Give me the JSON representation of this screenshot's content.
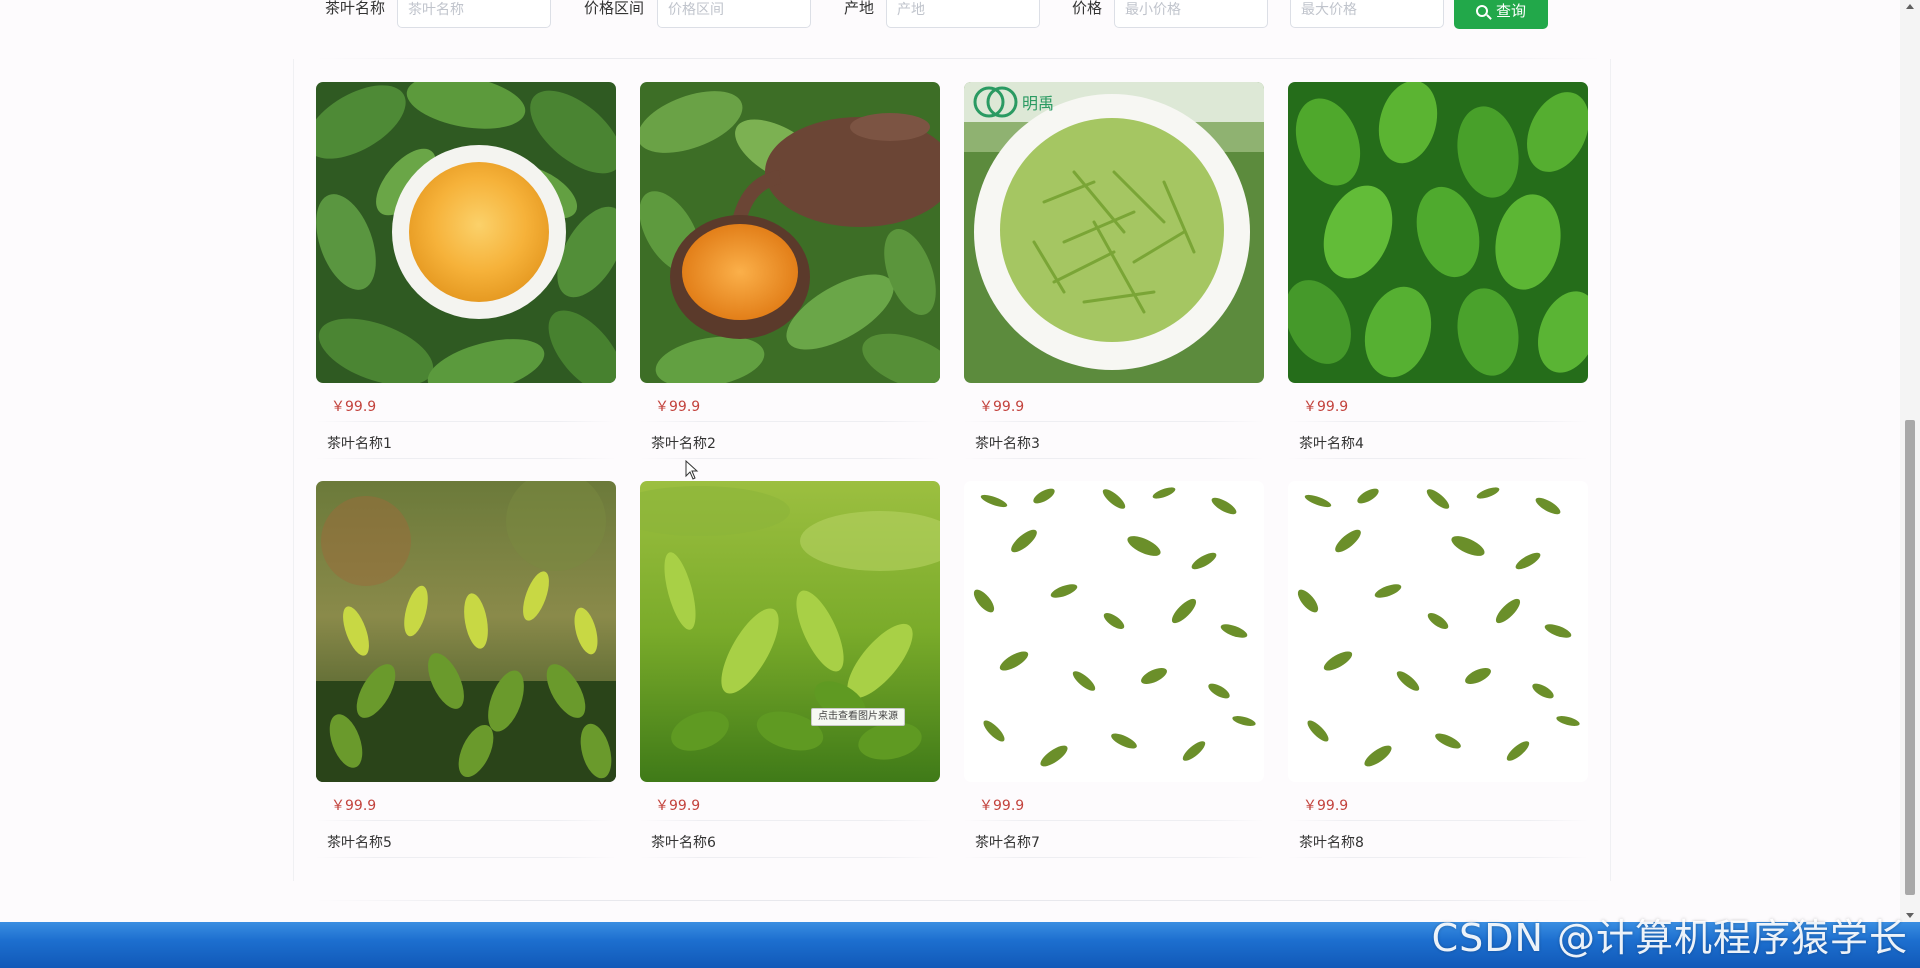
{
  "search": {
    "fields": [
      {
        "label": "茶叶名称",
        "placeholder": "茶叶名称"
      },
      {
        "label": "价格区间",
        "placeholder": "价格区间"
      },
      {
        "label": "产地",
        "placeholder": "产地"
      },
      {
        "label": "价格",
        "placeholder": "最小价格"
      },
      {
        "label": "",
        "placeholder": "最大价格"
      }
    ],
    "button_label": "查询"
  },
  "products": [
    {
      "name": "茶叶名称1",
      "price": "￥99.9",
      "image": "tea-cup-on-leaves"
    },
    {
      "name": "茶叶名称2",
      "price": "￥99.9",
      "image": "teapot-pouring-tea"
    },
    {
      "name": "茶叶名称3",
      "price": "￥99.9",
      "image": "green-tea-bowl"
    },
    {
      "name": "茶叶名称4",
      "price": "￥99.9",
      "image": "fresh-tea-shoots"
    },
    {
      "name": "茶叶名称5",
      "price": "￥99.9",
      "image": "tea-bush-sprouts"
    },
    {
      "name": "茶叶名称6",
      "price": "￥99.9",
      "image": "tea-garden-closeup"
    },
    {
      "name": "茶叶名称7",
      "price": "￥99.9",
      "image": "flying-tea-leaves"
    },
    {
      "name": "茶叶名称8",
      "price": "￥99.9",
      "image": "flying-tea-leaves"
    }
  ],
  "image_logo_text": "明禹",
  "image_tooltip": "点击查看图片来源",
  "watermark": "CSDN @计算机程序猿学长",
  "colors": {
    "accent": "#22a84a",
    "price": "#c3433d",
    "taskbar": "#1d6fcf"
  }
}
